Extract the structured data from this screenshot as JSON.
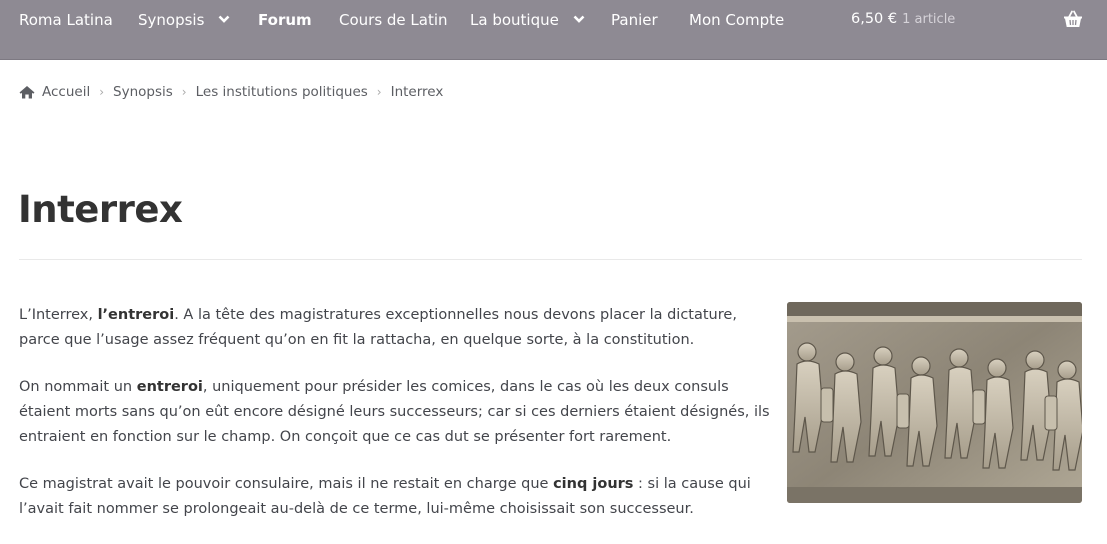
{
  "nav": {
    "items": [
      {
        "label": "Roma Latina"
      },
      {
        "label": "Synopsis"
      },
      {
        "label": "Forum"
      },
      {
        "label": "Cours de Latin"
      },
      {
        "label": "La boutique"
      },
      {
        "label": "Panier"
      },
      {
        "label": "Mon Compte"
      }
    ],
    "cart": {
      "amount": "6,50 €",
      "count": "1 article"
    }
  },
  "breadcrumb": [
    "Accueil",
    "Synopsis",
    "Les institutions politiques",
    "Interrex"
  ],
  "page": {
    "title": "Interrex",
    "p1": {
      "a": "L’Interrex, ",
      "b": "l’entreroi",
      "c": ". A la tête des magistratures exceptionnelles nous devons placer la dictature, parce que l’usage assez fréquent qu’on en fit la rattacha, en quelque sorte, à la constitution."
    },
    "p2": {
      "a": "On nommait un ",
      "b": "entreroi",
      "c": ", uniquement pour présider les comices, dans le cas où les deux consuls étaient morts sans qu’on eût encore désigné leurs successeurs; car si ces derniers étaient désignés, ils entraient en fonction sur le champ. On conçoit que ce cas dut se présenter fort rarement."
    },
    "p3": {
      "a": "Ce magistrat avait le pouvoir consulaire, mais il ne restait en charge que ",
      "b": "cinq jours",
      "c": " : si la cause qui l’avait fait nommer se prolongeait au-delà de ce terme, lui-même choisissait son successeur."
    }
  },
  "colors": {
    "topbar": "#8e8a93",
    "text": "#43454b",
    "title": "#333333"
  }
}
